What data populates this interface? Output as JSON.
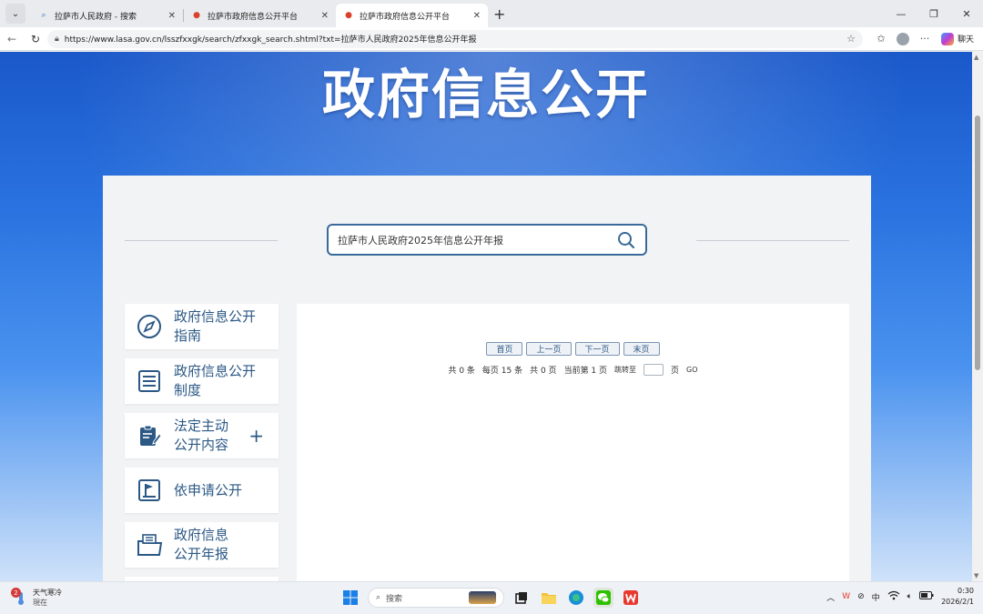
{
  "browser": {
    "tabs": [
      {
        "label": "拉萨市人民政府 - 搜索",
        "icon": "search-icon"
      },
      {
        "label": "拉萨市政府信息公开平台",
        "icon": "emblem-icon"
      },
      {
        "label": "拉萨市政府信息公开平台",
        "icon": "emblem-icon",
        "active": true
      }
    ],
    "url": "https://www.lasa.gov.cn/lsszfxxgk/search/zfxxgk_search.shtml?txt=拉萨市人民政府2025年信息公开年报",
    "chat_label": "聊天"
  },
  "page": {
    "hero_title": "政府信息公开",
    "search": {
      "value": "拉萨市人民政府2025年信息公开年报"
    },
    "menu": [
      {
        "line1": "政府信息公开",
        "line2": "指南",
        "icon": "compass-icon"
      },
      {
        "line1": "政府信息公开",
        "line2": "制度",
        "icon": "list-document-icon"
      },
      {
        "line1": "法定主动",
        "line2": "公开内容",
        "icon": "clipboard-edit-icon",
        "expand": "+"
      },
      {
        "line1": "依申请公开",
        "line2": "",
        "icon": "flag-board-icon"
      },
      {
        "line1": "政府信息",
        "line2": "公开年报",
        "icon": "folder-document-icon"
      }
    ],
    "pager": {
      "first": "首页",
      "prev": "上一页",
      "next": "下一页",
      "last": "末页",
      "total_items": "共 0 条",
      "per_page": "每页 15 条",
      "total_pages": "共 0 页",
      "current": "当前第 1 页",
      "jump_label": "跳转至",
      "page_unit": "页",
      "go": "GO"
    }
  },
  "taskbar": {
    "weather_title": "天气寒冷",
    "weather_sub": "現在",
    "weather_badge": "2",
    "search_placeholder": "搜索",
    "ime": "中",
    "time": "0:30",
    "date": "2026/2/1"
  }
}
